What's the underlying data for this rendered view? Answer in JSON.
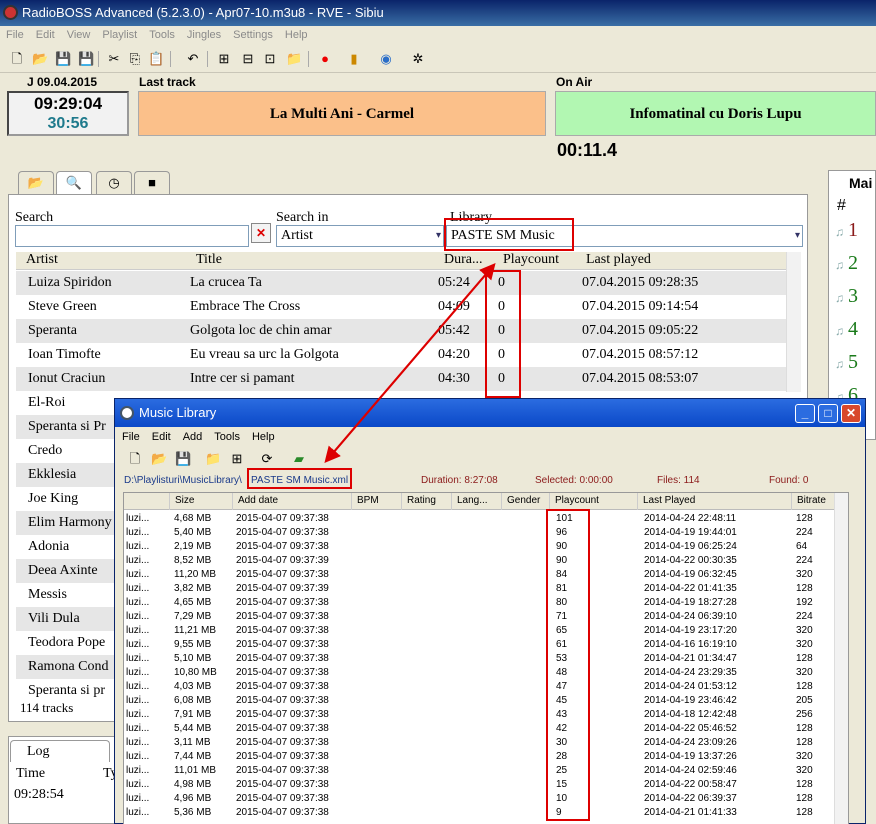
{
  "window": {
    "title": "RadioBOSS Advanced (5.2.3.0) - Apr07-10.m3u8 - RVE - Sibiu"
  },
  "menu": [
    "File",
    "Edit",
    "View",
    "Playlist",
    "Tools",
    "Jingles",
    "Settings",
    "Help"
  ],
  "header": {
    "date": "J 09.04.2015",
    "time": "09:29:04",
    "time2": "30:56",
    "last_track_label": "Last track",
    "last_track": "La Multi Ani - Carmel",
    "on_air_label": "On Air",
    "on_air": "Infomatinal cu Doris Lupu",
    "timer": "00:11.4"
  },
  "search": {
    "search_label": "Search",
    "search_value": "",
    "search_in_label": "Search in",
    "search_in_value": "Artist",
    "library_label": "Library",
    "library_value": "PASTE SM Music"
  },
  "grid": {
    "headers": {
      "artist": "Artist",
      "title": "Title",
      "duration": "Dura...",
      "playcount": "Playcount",
      "last_played": "Last played"
    },
    "rows": [
      {
        "artist": "Luiza Spiridon",
        "title": "La crucea Ta",
        "duration": "05:24",
        "playcount": "0",
        "last_played": "07.04.2015 09:28:35"
      },
      {
        "artist": "Steve Green",
        "title": "Embrace The Cross",
        "duration": "04:09",
        "playcount": "0",
        "last_played": "07.04.2015 09:14:54"
      },
      {
        "artist": "Speranta",
        "title": "Golgota loc de chin amar",
        "duration": "05:42",
        "playcount": "0",
        "last_played": "07.04.2015 09:05:22"
      },
      {
        "artist": "Ioan Timofte",
        "title": "Eu vreau sa urc la Golgota",
        "duration": "04:20",
        "playcount": "0",
        "last_played": "07.04.2015 08:57:12"
      },
      {
        "artist": "Ionut Craciun",
        "title": "Intre cer si pamant",
        "duration": "04:30",
        "playcount": "0",
        "last_played": "07.04.2015 08:53:07"
      },
      {
        "artist": "El-Roi",
        "title": "",
        "duration": "",
        "playcount": "",
        "last_played": ""
      },
      {
        "artist": "Speranta si Pr",
        "title": "",
        "duration": "",
        "playcount": "",
        "last_played": ""
      },
      {
        "artist": "Credo",
        "title": "",
        "duration": "",
        "playcount": "",
        "last_played": ""
      },
      {
        "artist": "Ekklesia",
        "title": "",
        "duration": "",
        "playcount": "",
        "last_played": ""
      },
      {
        "artist": "Joe King",
        "title": "",
        "duration": "",
        "playcount": "",
        "last_played": ""
      },
      {
        "artist": "Elim Harmony",
        "title": "",
        "duration": "",
        "playcount": "",
        "last_played": ""
      },
      {
        "artist": "Adonia",
        "title": "",
        "duration": "",
        "playcount": "",
        "last_played": ""
      },
      {
        "artist": "Deea Axinte",
        "title": "",
        "duration": "",
        "playcount": "",
        "last_played": ""
      },
      {
        "artist": "Messis",
        "title": "",
        "duration": "",
        "playcount": "",
        "last_played": ""
      },
      {
        "artist": "Vili Dula",
        "title": "",
        "duration": "",
        "playcount": "",
        "last_played": ""
      },
      {
        "artist": "Teodora Pope",
        "title": "",
        "duration": "",
        "playcount": "",
        "last_played": ""
      },
      {
        "artist": "Ramona Cond",
        "title": "",
        "duration": "",
        "playcount": "",
        "last_played": ""
      },
      {
        "artist": "Speranta si pr",
        "title": "",
        "duration": "",
        "playcount": "",
        "last_played": ""
      }
    ],
    "footer": "114 tracks"
  },
  "right_panel": {
    "tab": "Mai",
    "header": "#",
    "numbers": [
      "1",
      "2",
      "3",
      "4",
      "5",
      "6"
    ]
  },
  "log": {
    "tab": "Log",
    "col_time": "Time",
    "col_type": "Ty",
    "row_time": "09:28:54"
  },
  "music_library": {
    "title": "Music Library",
    "menu": [
      "File",
      "Edit",
      "Add",
      "Tools",
      "Help"
    ],
    "path_prefix": "D:\\Playlisturi\\MusicLibrary\\",
    "path_file": "PASTE SM Music.xml",
    "duration": "Duration: 8:27:08",
    "selected": "Selected: 0:00:00",
    "files": "Files: 114",
    "found": "Found: 0",
    "headers": [
      "Size",
      "Add date",
      "BPM",
      "Rating",
      "Lang...",
      "Gender",
      "Playcount",
      "Last Played",
      "Bitrate"
    ],
    "rows": [
      {
        "c": "luzi...",
        "size": "4,68 MB",
        "date": "2015-04-07 09:37:38",
        "pc": "101",
        "lp": "2014-04-24 22:48:11",
        "br": "128"
      },
      {
        "c": "luzi...",
        "size": "5,40 MB",
        "date": "2015-04-07 09:37:38",
        "pc": "96",
        "lp": "2014-04-19 19:44:01",
        "br": "224"
      },
      {
        "c": "luzi...",
        "size": "2,19 MB",
        "date": "2015-04-07 09:37:38",
        "pc": "90",
        "lp": "2014-04-19 06:25:24",
        "br": "64"
      },
      {
        "c": "luzi...",
        "size": "8,52 MB",
        "date": "2015-04-07 09:37:39",
        "pc": "90",
        "lp": "2014-04-22 00:30:35",
        "br": "224"
      },
      {
        "c": "luzi...",
        "size": "11,20 MB",
        "date": "2015-04-07 09:37:38",
        "pc": "84",
        "lp": "2014-04-19 06:32:45",
        "br": "320"
      },
      {
        "c": "luzi...",
        "size": "3,82 MB",
        "date": "2015-04-07 09:37:39",
        "pc": "81",
        "lp": "2014-04-22 01:41:35",
        "br": "128"
      },
      {
        "c": "luzi...",
        "size": "4,65 MB",
        "date": "2015-04-07 09:37:38",
        "pc": "80",
        "lp": "2014-04-19 18:27:28",
        "br": "192"
      },
      {
        "c": "luzi...",
        "size": "7,29 MB",
        "date": "2015-04-07 09:37:38",
        "pc": "71",
        "lp": "2014-04-24 06:39:10",
        "br": "224"
      },
      {
        "c": "luzi...",
        "size": "11,21 MB",
        "date": "2015-04-07 09:37:38",
        "pc": "65",
        "lp": "2014-04-19 23:17:20",
        "br": "320"
      },
      {
        "c": "luzi...",
        "size": "9,55 MB",
        "date": "2015-04-07 09:37:38",
        "pc": "61",
        "lp": "2014-04-16 16:19:10",
        "br": "320"
      },
      {
        "c": "luzi...",
        "size": "5,10 MB",
        "date": "2015-04-07 09:37:38",
        "pc": "53",
        "lp": "2014-04-21 01:34:47",
        "br": "128"
      },
      {
        "c": "luzi...",
        "size": "10,80 MB",
        "date": "2015-04-07 09:37:38",
        "pc": "48",
        "lp": "2014-04-24 23:29:35",
        "br": "320"
      },
      {
        "c": "luzi...",
        "size": "4,03 MB",
        "date": "2015-04-07 09:37:38",
        "pc": "47",
        "lp": "2014-04-24 01:53:12",
        "br": "128"
      },
      {
        "c": "luzi...",
        "size": "6,08 MB",
        "date": "2015-04-07 09:37:38",
        "pc": "45",
        "lp": "2014-04-19 23:46:42",
        "br": "205"
      },
      {
        "c": "luzi...",
        "size": "7,91 MB",
        "date": "2015-04-07 09:37:38",
        "pc": "43",
        "lp": "2014-04-18 12:42:48",
        "br": "256"
      },
      {
        "c": "luzi...",
        "size": "5,44 MB",
        "date": "2015-04-07 09:37:38",
        "pc": "42",
        "lp": "2014-04-22 05:46:52",
        "br": "128"
      },
      {
        "c": "luzi...",
        "size": "3,11 MB",
        "date": "2015-04-07 09:37:38",
        "pc": "30",
        "lp": "2014-04-24 23:09:26",
        "br": "128"
      },
      {
        "c": "luzi...",
        "size": "7,44 MB",
        "date": "2015-04-07 09:37:38",
        "pc": "28",
        "lp": "2014-04-19 13:37:26",
        "br": "320"
      },
      {
        "c": "luzi...",
        "size": "11,01 MB",
        "date": "2015-04-07 09:37:38",
        "pc": "25",
        "lp": "2014-04-24 02:59:46",
        "br": "320"
      },
      {
        "c": "luzi...",
        "size": "4,98 MB",
        "date": "2015-04-07 09:37:38",
        "pc": "15",
        "lp": "2014-04-22 00:58:47",
        "br": "128"
      },
      {
        "c": "luzi...",
        "size": "4,96 MB",
        "date": "2015-04-07 09:37:38",
        "pc": "10",
        "lp": "2014-04-22 06:39:37",
        "br": "128"
      },
      {
        "c": "luzi...",
        "size": "5,36 MB",
        "date": "2015-04-07 09:37:38",
        "pc": "9",
        "lp": "2014-04-21 01:41:33",
        "br": "128"
      }
    ]
  },
  "colors": {
    "last_track_bg": "#fbc08a",
    "on_air_bg": "#b2f7b2",
    "highlight": "#dd0000",
    "number_color": "#8b1a1a"
  }
}
